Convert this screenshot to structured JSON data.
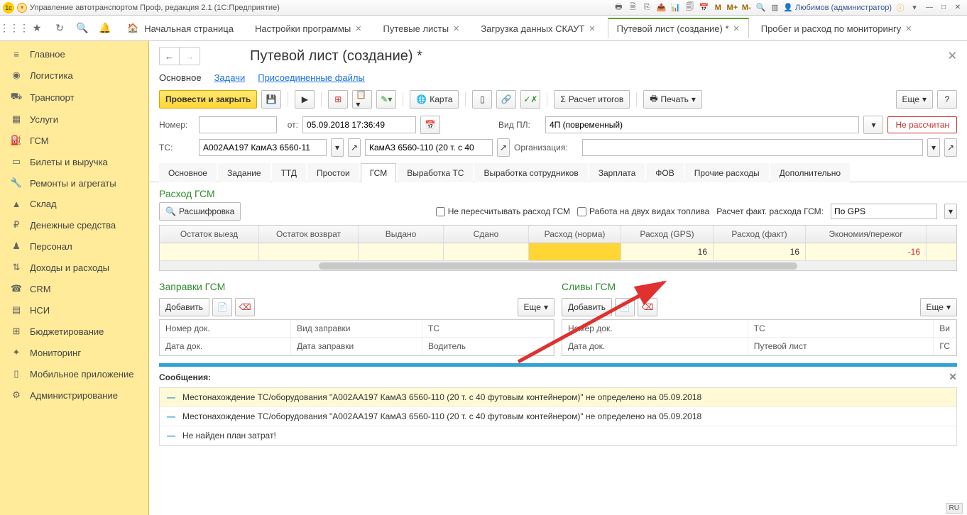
{
  "window": {
    "title": "Управление автотранспортом Проф, редакция 2.1  (1С:Предприятие)",
    "user": "Любимов (администратор)",
    "M_labels": [
      "M",
      "M+",
      "M-"
    ]
  },
  "top_tabs": {
    "home": "Начальная страница",
    "items": [
      {
        "label": "Настройки программы"
      },
      {
        "label": "Путевые листы"
      },
      {
        "label": "Загрузка данных СКАУТ"
      },
      {
        "label": "Путевой лист (создание) *",
        "active": true
      },
      {
        "label": "Пробег и расход по мониторингу"
      }
    ]
  },
  "sidebar": [
    {
      "icon": "≡",
      "label": "Главное"
    },
    {
      "icon": "◉",
      "label": "Логистика"
    },
    {
      "icon": "⛟",
      "label": "Транспорт"
    },
    {
      "icon": "▦",
      "label": "Услуги"
    },
    {
      "icon": "⛽",
      "label": "ГСМ"
    },
    {
      "icon": "▭",
      "label": "Билеты и выручка"
    },
    {
      "icon": "🔧",
      "label": "Ремонты и агрегаты"
    },
    {
      "icon": "▲",
      "label": "Склад"
    },
    {
      "icon": "₽",
      "label": "Денежные средства"
    },
    {
      "icon": "♟",
      "label": "Персонал"
    },
    {
      "icon": "⇅",
      "label": "Доходы и расходы"
    },
    {
      "icon": "☎",
      "label": "CRM"
    },
    {
      "icon": "▤",
      "label": "НСИ"
    },
    {
      "icon": "⊞",
      "label": "Бюджетирование"
    },
    {
      "icon": "✦",
      "label": "Мониторинг"
    },
    {
      "icon": "▯",
      "label": "Мобильное приложение"
    },
    {
      "icon": "⚙",
      "label": "Администрирование"
    }
  ],
  "page": {
    "title": "Путевой лист (создание) *",
    "subnav": [
      "Основное",
      "Задачи",
      "Присоединенные файлы"
    ]
  },
  "toolbar": {
    "primary": "Провести и закрыть",
    "map": "Карта",
    "calc": "Расчет итогов",
    "print": "Печать",
    "more": "Еще",
    "help": "?"
  },
  "form": {
    "number_label": "Номер:",
    "number_value": "",
    "from_label": "от:",
    "from_value": "05.09.2018 17:36:49",
    "vid_label": "Вид ПЛ:",
    "vid_value": "4П (повременный)",
    "nr_badge": "Не рассчитан",
    "ts_label": "ТС:",
    "ts_value": "А002АА197 КамАЗ 6560-11",
    "ts2_value": "КамАЗ 6560-110 (20 т. с 40",
    "org_label": "Организация:",
    "org_value": ""
  },
  "inner_tabs": [
    "Основное",
    "Задание",
    "ТТД",
    "Простои",
    "ГСМ",
    "Выработка ТС",
    "Выработка сотрудников",
    "Зарплата",
    "ФОВ",
    "Прочие расходы",
    "Дополнительно"
  ],
  "inner_active": "ГСМ",
  "fuel": {
    "section_title": "Расход ГСМ",
    "decode_btn": "Расшифровка",
    "chk1": "Не пересчитывать расход ГСМ",
    "chk2": "Работа на двух видах топлива",
    "calc_label": "Расчет факт. расхода ГСМ:",
    "calc_value": "По GPS",
    "columns": [
      "Остаток выезд",
      "Остаток возврат",
      "Выдано",
      "Сдано",
      "Расход (норма)",
      "Расход (GPS)",
      "Расход (факт)",
      "Экономия/пережог"
    ],
    "row": [
      "",
      "",
      "",
      "",
      "",
      "16",
      "16",
      "-16"
    ]
  },
  "refuel": {
    "title": "Заправки ГСМ",
    "add": "Добавить",
    "more": "Еще",
    "row1": [
      "Номер док.",
      "Вид заправки",
      "ТС"
    ],
    "row2": [
      "Дата док.",
      "Дата заправки",
      "Водитель"
    ]
  },
  "drain": {
    "title": "Сливы ГСМ",
    "add": "Добавить",
    "more": "Еще",
    "row1": [
      "Номер док.",
      "ТС",
      "Ви"
    ],
    "row2": [
      "Дата док.",
      "Путевой лист",
      "ГС"
    ]
  },
  "messages": {
    "title": "Сообщения:",
    "items": [
      "Местонахождение ТС/оборудования \"А002АА197 КамАЗ 6560-110 (20 т. с 40 футовым контейнером)\" не определено на 05.09.2018",
      "Местонахождение ТС/оборудования \"А002АА197 КамАЗ 6560-110 (20 т. с 40 футовым контейнером)\" не определено на 05.09.2018",
      "Не найден план затрат!"
    ]
  },
  "lang": "RU"
}
